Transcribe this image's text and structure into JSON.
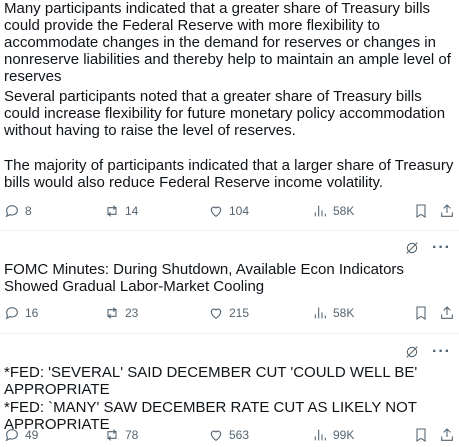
{
  "posts": [
    {
      "paragraphs": [
        "Many participants indicated that a greater share of Treasury bills could provide the Federal Reserve with more flexibility to accommodate changes in the demand for reserves or changes in nonreserve liabilities and thereby help to maintain an ample level of reserves",
        "Several participants noted that a greater share of Treasury bills could increase flexibility for future monetary policy accommodation without having to raise the level of reserves.",
        "The majority of participants indicated that a larger share of Treasury bills would also reduce Federal Reserve income volatility."
      ],
      "replies": "8",
      "reposts": "14",
      "likes": "104",
      "views": "58K"
    },
    {
      "paragraphs": [
        "FOMC Minutes: During Shutdown, Available Econ Indicators Showed Gradual Labor-Market Cooling"
      ],
      "replies": "16",
      "reposts": "23",
      "likes": "215",
      "views": "58K",
      "more_label": "···"
    },
    {
      "paragraphs": [
        "*FED: 'SEVERAL' SAID DECEMBER CUT 'COULD WELL BE' APPROPRIATE",
        "*FED: `MANY' SAW DECEMBER RATE CUT AS LIKELY NOT APPROPRIATE"
      ],
      "replies": "49",
      "reposts": "78",
      "likes": "563",
      "views": "99K",
      "more_label": "···"
    }
  ],
  "icons": {
    "reply": "reply-icon",
    "repost": "repost-icon",
    "like": "heart-icon",
    "views": "views-icon",
    "bookmark": "bookmark-icon",
    "share": "share-icon",
    "grok": "grok-icon"
  }
}
